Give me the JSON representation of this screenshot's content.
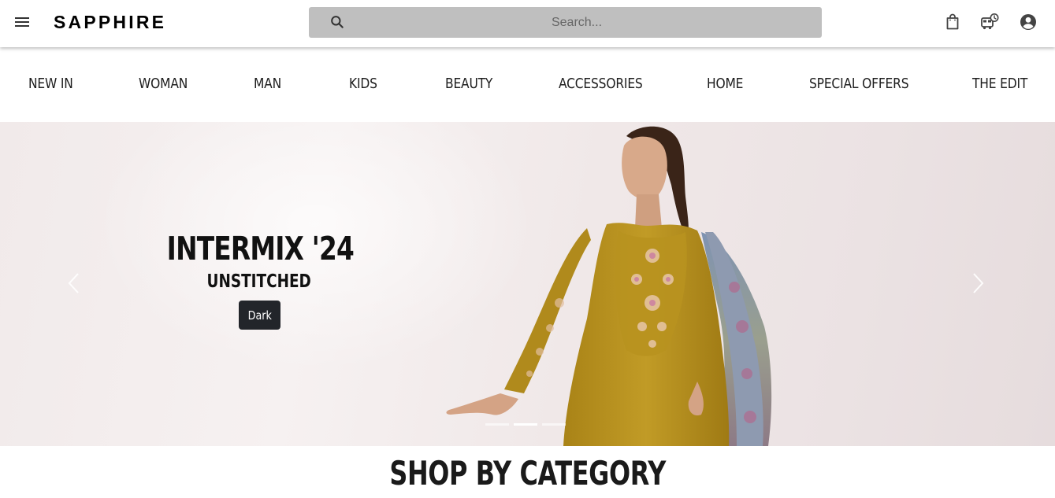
{
  "header": {
    "logo": "SAPPHIRE",
    "search_placeholder": "Search..."
  },
  "icons": {
    "menu": "hamburger-menu-icon",
    "search": "search-icon",
    "bag": "shopping-bag-icon",
    "tracking": "order-tracking-icon",
    "account": "account-icon"
  },
  "nav": {
    "items": [
      {
        "label": "NEW IN"
      },
      {
        "label": "WOMAN"
      },
      {
        "label": "MAN"
      },
      {
        "label": "KIDS"
      },
      {
        "label": "BEAUTY"
      },
      {
        "label": "ACCESSORIES"
      },
      {
        "label": "HOME"
      },
      {
        "label": "SPECIAL OFFERS"
      },
      {
        "label": "THE EDIT"
      }
    ]
  },
  "hero": {
    "title": "INTERMIX '24",
    "subtitle": "UNSTITCHED",
    "button_label": "Dark",
    "slides_total": 3,
    "active_slide": 2
  },
  "sections": {
    "category_title": "SHOP BY CATEGORY"
  },
  "colors": {
    "search_bg": "#bfbfbf",
    "button_bg": "#22252a",
    "outfit": "#b8921f"
  }
}
